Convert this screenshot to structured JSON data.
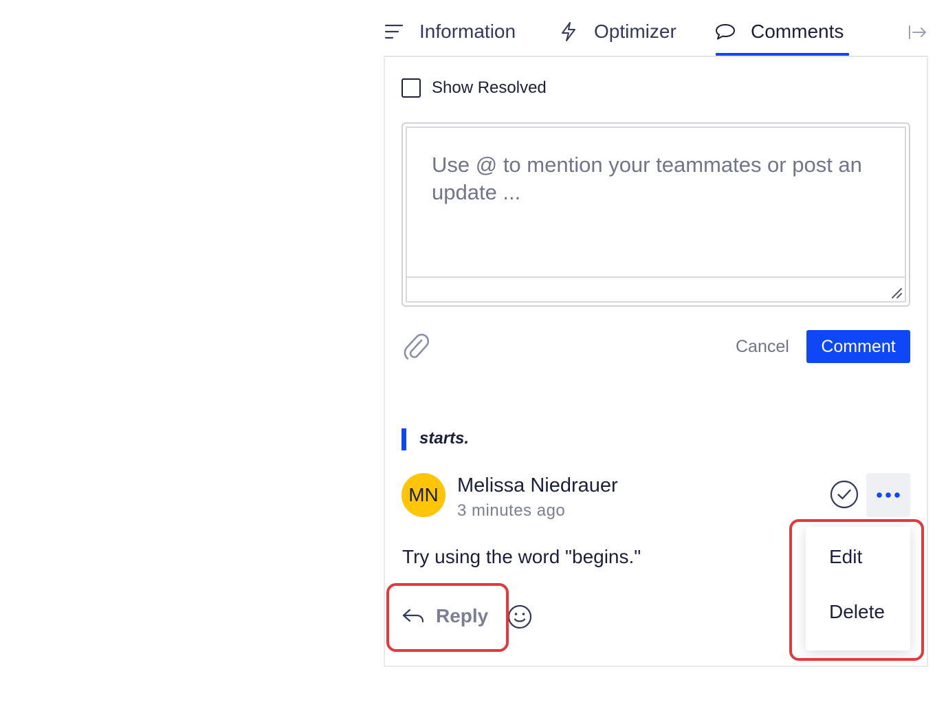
{
  "tabs": [
    {
      "label": "Information",
      "icon": "lines-icon"
    },
    {
      "label": "Optimizer",
      "icon": "lightning-icon"
    },
    {
      "label": "Comments",
      "icon": "speech-bubble-icon",
      "active": true
    }
  ],
  "colors": {
    "accent": "#0d47f7",
    "avatar_bg": "#ffc506",
    "highlight": "#e5383b"
  },
  "filter": {
    "show_resolved_label": "Show Resolved",
    "show_resolved_checked": false
  },
  "composer": {
    "placeholder": "Use @ to mention your teammates or post an update ...",
    "cancel_label": "Cancel",
    "submit_label": "Comment"
  },
  "thread": {
    "quoted_text": "starts.",
    "comment": {
      "avatar_initials": "MN",
      "author": "Melissa Niedrauer",
      "time": "3 minutes ago",
      "body": "Try using the word \"begins.\"",
      "reply_label": "Reply"
    },
    "menu": {
      "edit_label": "Edit",
      "delete_label": "Delete"
    }
  }
}
